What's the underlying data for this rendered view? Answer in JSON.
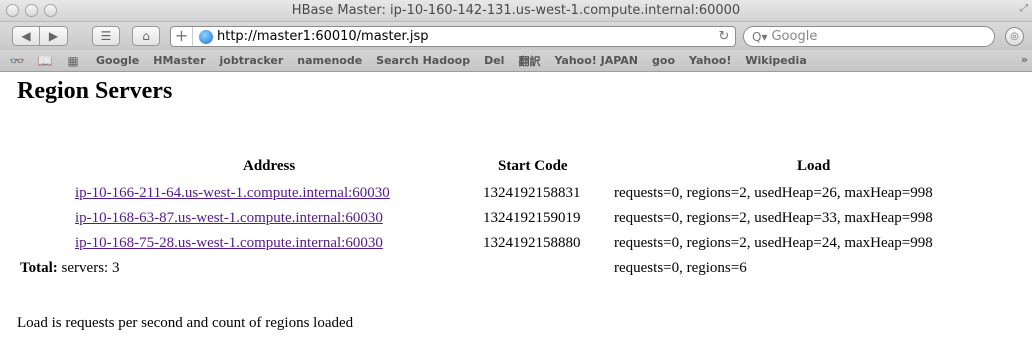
{
  "window": {
    "title": "HBase Master: ip-10-160-142-131.us-west-1.compute.internal:60000"
  },
  "toolbar": {
    "back_icon": "◀",
    "forward_icon": "▶",
    "sidebar_icon": "☰",
    "home_icon": "⌂",
    "add_icon": "+",
    "url": "http://master1:60010/master.jsp",
    "reload_icon": "↻",
    "search_placeholder": "Google",
    "search_icon": "Q▾"
  },
  "bookmarks": {
    "icons": [
      "reader-icon",
      "book-icon",
      "grid-icon"
    ],
    "items": [
      "Google",
      "HMaster",
      "jobtracker",
      "namenode",
      "Search Hadoop",
      "Del",
      "翻訳",
      "Yahoo! JAPAN",
      "goo",
      "Yahoo!",
      "Wikipedia"
    ]
  },
  "page": {
    "heading": "Region Servers",
    "columns": {
      "address": "Address",
      "start_code": "Start Code",
      "load": "Load"
    },
    "rows": [
      {
        "address": "ip-10-166-211-64.us-west-1.compute.internal:60030",
        "start_code": "1324192158831",
        "load": "requests=0, regions=2, usedHeap=26, maxHeap=998"
      },
      {
        "address": "ip-10-168-63-87.us-west-1.compute.internal:60030",
        "start_code": "1324192159019",
        "load": "requests=0, regions=2, usedHeap=33, maxHeap=998"
      },
      {
        "address": "ip-10-168-75-28.us-west-1.compute.internal:60030",
        "start_code": "1324192158880",
        "load": "requests=0, regions=2, usedHeap=24, maxHeap=998"
      }
    ],
    "total": {
      "label": "Total:",
      "servers": "servers: 3",
      "load": "requests=0, regions=6"
    },
    "note": "Load is requests per second and count of regions loaded"
  },
  "colors": {
    "link": "#551a8b"
  }
}
